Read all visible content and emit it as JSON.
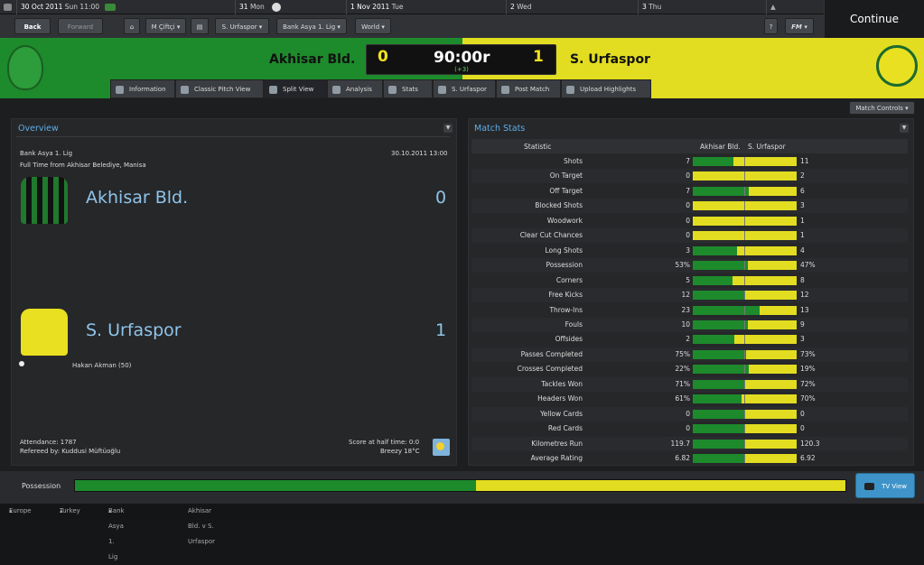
{
  "calendar": {
    "today_date": "30 Oct 2011",
    "today_time": "Sun 11:00",
    "day1": "31",
    "day1_name": "Mon",
    "day2": "1 Nov 2011",
    "day2_name": "Tue",
    "day3": "2",
    "day3_name": "Wed",
    "day4": "3",
    "day4_name": "Thu"
  },
  "nav": {
    "back": "Back",
    "forward": "Forward",
    "manager": "M Çiftçi",
    "club": "S. Urfaspor",
    "competition": "Bank Asya 1. Lig",
    "world": "World",
    "help": "?",
    "fm": "FM"
  },
  "continue_label": "Continue",
  "header": {
    "home_team": "Akhisar Bld.",
    "away_team": "S. Urfaspor",
    "home_score": "0",
    "away_score": "1",
    "clock": "90:00r",
    "added_time": "(+3)"
  },
  "tabs": [
    "Information",
    "Classic Pitch View",
    "Split View",
    "Analysis",
    "Stats",
    "S. Urfaspor",
    "Post Match",
    "Upload Highlights"
  ],
  "match_controls": "Match Controls",
  "overview": {
    "title": "Overview",
    "competition": "Bank Asya 1. Lig",
    "result_line": "Full Time from Akhisar Belediye, Manisa",
    "datetime": "30.10.2011 13:00",
    "home_team": "Akhisar Bld.",
    "home_score": "0",
    "away_team": "S. Urfaspor",
    "away_score": "1",
    "scorer": "Hakan Akman (50)",
    "attendance": "Attendance: 1787",
    "referee": "Refereed by: Kuddusi Müftüoğlu",
    "half_time": "Score at half time: 0:0",
    "weather": "Breezy 18°C"
  },
  "match_stats": {
    "title": "Match Stats",
    "col_statistic": "Statistic",
    "col_home": "Akhisar Bld.",
    "col_away": "S. Urfaspor",
    "rows": [
      {
        "label": "Shots",
        "home": "7",
        "away": "11",
        "home_share": 0.39
      },
      {
        "label": "On Target",
        "home": "0",
        "away": "2",
        "home_share": 0.0
      },
      {
        "label": "Off Target",
        "home": "7",
        "away": "6",
        "home_share": 0.54
      },
      {
        "label": "Blocked Shots",
        "home": "0",
        "away": "3",
        "home_share": 0.0
      },
      {
        "label": "Woodwork",
        "home": "0",
        "away": "1",
        "home_share": 0.0
      },
      {
        "label": "Clear Cut Chances",
        "home": "0",
        "away": "1",
        "home_share": 0.0
      },
      {
        "label": "Long Shots",
        "home": "3",
        "away": "4",
        "home_share": 0.43
      },
      {
        "label": "Possession",
        "home": "53%",
        "away": "47%",
        "home_share": 0.53
      },
      {
        "label": "Corners",
        "home": "5",
        "away": "8",
        "home_share": 0.38
      },
      {
        "label": "Free Kicks",
        "home": "12",
        "away": "12",
        "home_share": 0.5
      },
      {
        "label": "Throw-Ins",
        "home": "23",
        "away": "13",
        "home_share": 0.64
      },
      {
        "label": "Fouls",
        "home": "10",
        "away": "9",
        "home_share": 0.53
      },
      {
        "label": "Offsides",
        "home": "2",
        "away": "3",
        "home_share": 0.4
      },
      {
        "label": "Passes Completed",
        "home": "75%",
        "away": "73%",
        "home_share": 0.51
      },
      {
        "label": "Crosses Completed",
        "home": "22%",
        "away": "19%",
        "home_share": 0.54
      },
      {
        "label": "Tackles Won",
        "home": "71%",
        "away": "72%",
        "home_share": 0.5
      },
      {
        "label": "Headers Won",
        "home": "61%",
        "away": "70%",
        "home_share": 0.47
      },
      {
        "label": "Yellow Cards",
        "home": "0",
        "away": "0",
        "home_share": 0.5
      },
      {
        "label": "Red Cards",
        "home": "0",
        "away": "0",
        "home_share": 0.5
      },
      {
        "label": "Kilometres Run",
        "home": "119.7",
        "away": "120.3",
        "home_share": 0.5
      },
      {
        "label": "Average Rating",
        "home": "6.82",
        "away": "6.92",
        "home_share": 0.5
      }
    ]
  },
  "possession": {
    "label": "Possession",
    "home_share": 0.52
  },
  "tv_view": "TV View",
  "breadcrumbs": [
    "Europe",
    "Turkey",
    "Bank Asya 1. Lig",
    "Akhisar Bld. v S. Urfaspor"
  ],
  "colors": {
    "home": "#1d8a2c",
    "away": "#e2dd20",
    "accent": "#5eaee8"
  }
}
